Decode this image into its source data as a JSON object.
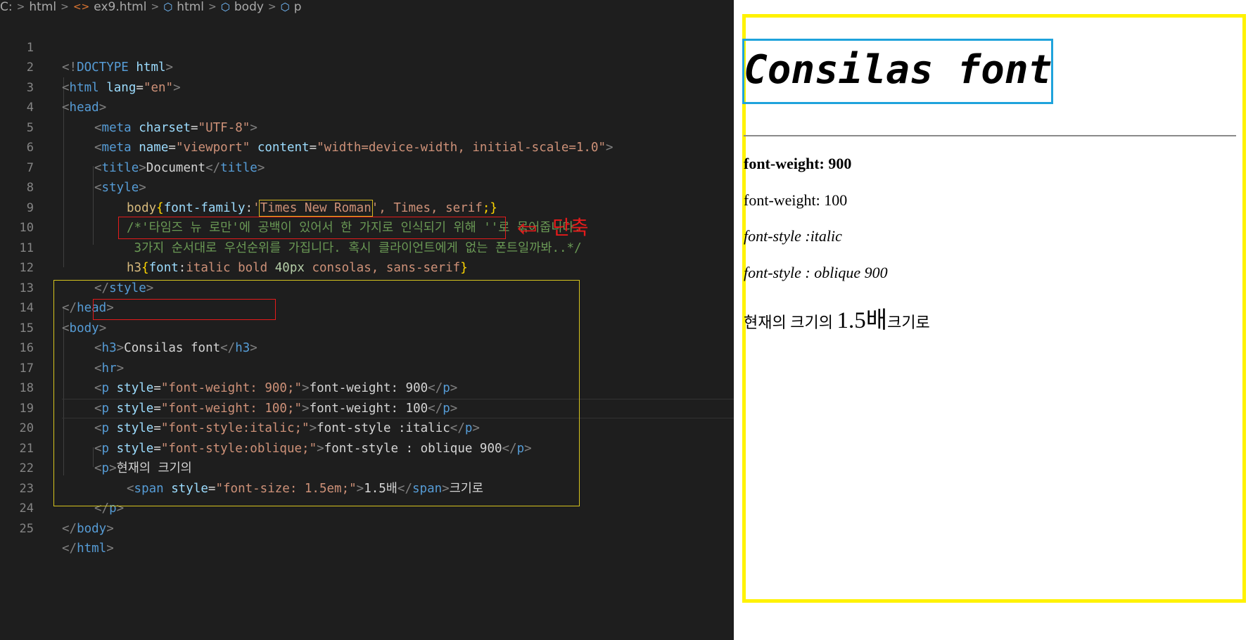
{
  "breadcrumb": {
    "root": "C:",
    "items": [
      "html",
      "ex9.html",
      "html",
      "body",
      "p"
    ]
  },
  "editor": {
    "line_numbers": [
      "1",
      "2",
      "3",
      "4",
      "5",
      "6",
      "7",
      "8",
      "9",
      "10",
      "11",
      "12",
      "13",
      "14",
      "15",
      "16",
      "17",
      "18",
      "19",
      "20",
      "21",
      "22",
      "23",
      "24",
      "25"
    ],
    "lines": {
      "l1": [
        "<!",
        "DOCTYPE",
        " html",
        ">"
      ],
      "l2": [
        "<",
        "html",
        " lang",
        "=",
        "\"en\"",
        ">"
      ],
      "l3": [
        "<",
        "head",
        ">"
      ],
      "l4": [
        "<",
        "meta",
        " charset",
        "=",
        "\"UTF-8\"",
        ">"
      ],
      "l5": [
        "<",
        "meta",
        " name",
        "=",
        "\"viewport\"",
        " content",
        "=",
        "\"width=device-width, initial-scale=1.0\"",
        ">"
      ],
      "l6": [
        "<",
        "title",
        ">",
        "Document",
        "</",
        "title",
        ">"
      ],
      "l7": [
        "<",
        "style",
        ">"
      ],
      "l8": [
        "body",
        "{",
        "font-family",
        ":",
        "'",
        "Times New Roman",
        "'",
        ", Times, serif",
        ";}"
      ],
      "l9": "/*'타임즈 뉴 로만'에 공백이 있어서 한 가지로 인식되기 위해 ''로 묶어줍니다.",
      "l10": " 3가지 순서대로 우선순위를 가집니다. 혹시 클라이언트에게 없는 폰트일까봐..*/",
      "l11": [
        "h3",
        "{",
        "font",
        ":",
        "italic bold ",
        "40px",
        " consolas, sans-serif",
        "}"
      ],
      "l12": [
        "</",
        "style",
        ">"
      ],
      "l13": [
        "</",
        "head",
        ">"
      ],
      "l14": [
        "<",
        "body",
        ">"
      ],
      "l15": [
        "<",
        "h3",
        ">",
        "Consilas font",
        "</",
        "h3",
        ">"
      ],
      "l16": [
        "<",
        "hr",
        ">"
      ],
      "l17": [
        "<",
        "p",
        " style",
        "=",
        "\"font-weight: 900;\"",
        ">",
        "font-weight: 900",
        "</",
        "p",
        ">"
      ],
      "l18": [
        "<",
        "p",
        " style",
        "=",
        "\"font-weight: 100;\"",
        ">",
        "font-weight: 100",
        "</",
        "p",
        ">"
      ],
      "l19": [
        "<",
        "p",
        " style",
        "=",
        "\"font-style:italic;\"",
        ">",
        "font-style :italic",
        "</",
        "p",
        ">"
      ],
      "l20": [
        "<",
        "p",
        " style",
        "=",
        "\"font-style:oblique;\"",
        ">",
        "font-style : oblique 900",
        "</",
        "p",
        ">"
      ],
      "l21": [
        "<",
        "p",
        ">",
        "현재의 크기의"
      ],
      "l22": [
        "<",
        "span",
        " style",
        "=",
        "\"font-size: 1.5em;\"",
        ">",
        "1.5배",
        "</",
        "span",
        ">",
        "크기로"
      ],
      "l23": [
        "</",
        "p",
        ">"
      ],
      "l24": [
        "</",
        "body",
        ">"
      ],
      "l25": [
        "</",
        "html",
        ">"
      ]
    },
    "annotation": {
      "arrow": "⇦",
      "label": "단축"
    }
  },
  "preview": {
    "h3": "Consilas font",
    "p1": "font-weight: 900",
    "p2": "font-weight: 100",
    "p3": "font-style :italic",
    "p4": "font-style : oblique 900",
    "p5_before": "현재의 크기의 ",
    "p5_span": "1.5배",
    "p5_after": "크기로"
  },
  "colors": {
    "editor_bg": "#1e1e1e",
    "annotation_red": "#e51b1b",
    "highlight_yellow": "#fff200",
    "h3_box_blue": "#1fa3dc"
  }
}
